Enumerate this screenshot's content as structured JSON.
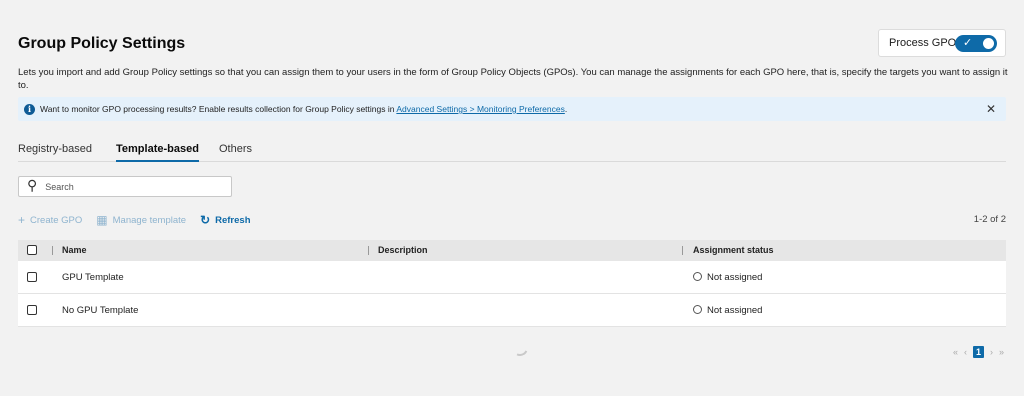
{
  "header": {
    "title": "Group Policy Settings",
    "process_label": "Process GPOs",
    "process_toggle_on": true,
    "description": "Lets you import and add Group Policy settings so that you can assign them to your users in the form of Group Policy Objects (GPOs). You can manage the assignments for each GPO here, that is, specify the targets you want to assign it to."
  },
  "banner": {
    "text": "Want to monitor GPO processing results? Enable results collection for Group Policy settings in ",
    "link": "Advanced Settings > Monitoring Preferences",
    "suffix": ".",
    "close_glyph": "✕"
  },
  "tabs": [
    {
      "label": "Registry-based",
      "active": false
    },
    {
      "label": "Template-based",
      "active": true
    },
    {
      "label": "Others",
      "active": false
    }
  ],
  "search": {
    "placeholder": "Search"
  },
  "toolbar": {
    "create": "Create GPO",
    "manage": "Manage template",
    "refresh": "Refresh",
    "count": "1-2 of 2"
  },
  "table": {
    "columns": [
      "Name",
      "Description",
      "Assignment status"
    ],
    "rows": [
      {
        "name": "GPU Template",
        "description": "",
        "status": "Not assigned"
      },
      {
        "name": "No GPU Template",
        "description": "",
        "status": "Not assigned"
      }
    ]
  },
  "pagination": {
    "first": "«",
    "prev": "‹",
    "current": "1",
    "next": "›",
    "last": "»"
  },
  "colors": {
    "accent": "#0e6aa8",
    "banner_bg": "#e5f1fb",
    "page_bg": "#f2f2f2"
  }
}
